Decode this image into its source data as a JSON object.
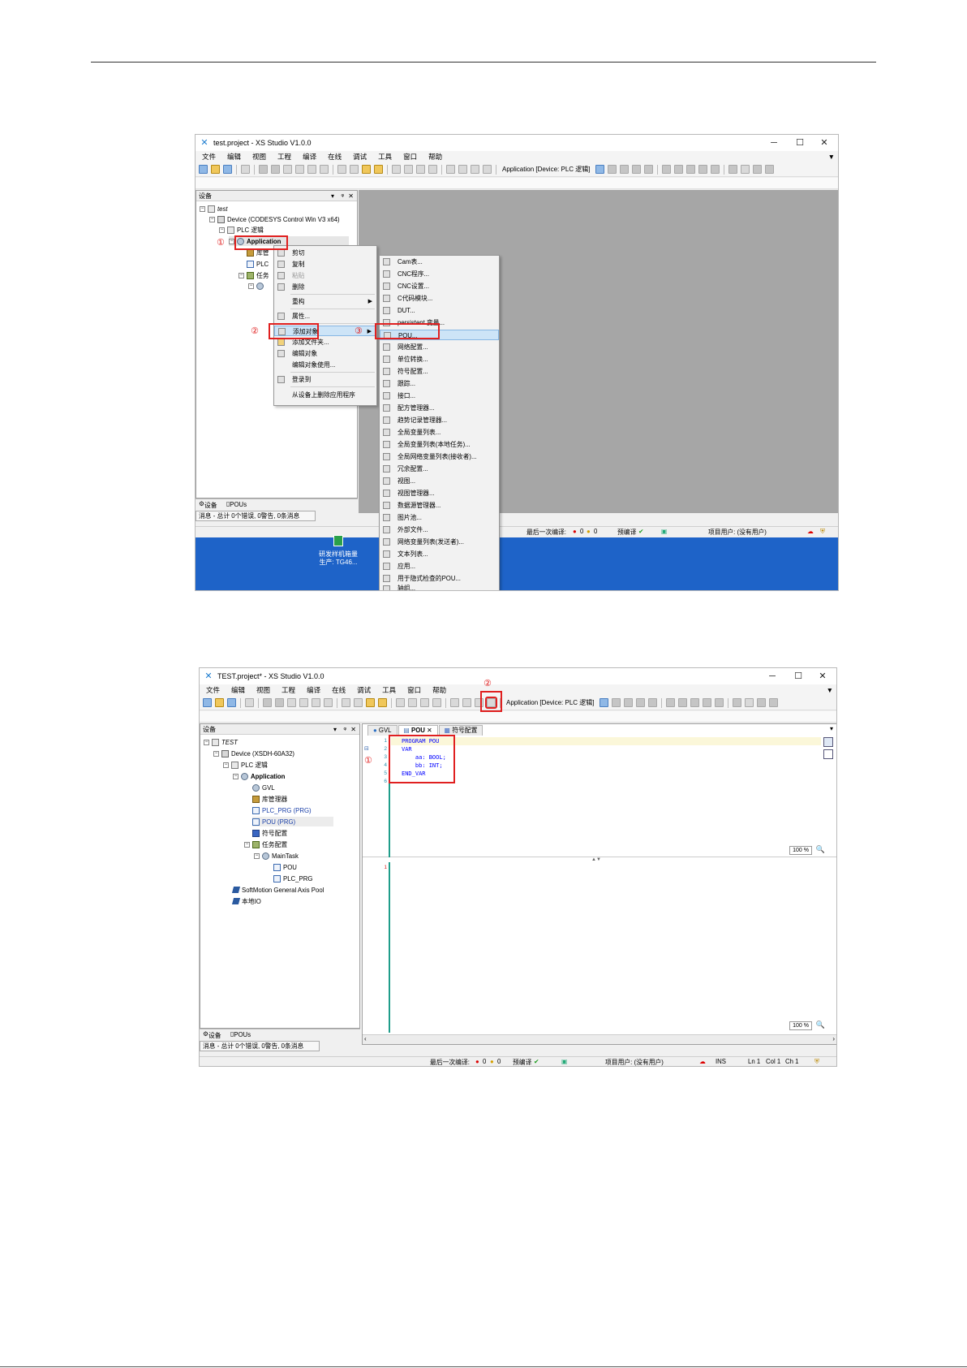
{
  "shot1": {
    "title": "test.project - XS Studio V1.0.0",
    "menu": [
      "文件",
      "编辑",
      "视图",
      "工程",
      "编译",
      "在线",
      "调试",
      "工具",
      "窗口",
      "帮助"
    ],
    "toolbar_app": "Application [Device: PLC 逻辑]",
    "devices_title": "设备",
    "tree": {
      "root": "test",
      "device": "Device (CODESYS Control Win V3 x64)",
      "plc": "PLC 逻辑",
      "application": "Application",
      "lib": "库管",
      "plcprg": "PLC",
      "task": "任务"
    },
    "context_menu": [
      "剪切",
      "复制",
      "粘贴",
      "删除",
      "重构",
      "属性...",
      "添加对象",
      "添加文件夹...",
      "编辑对象",
      "编辑对象使用...",
      "登录到",
      "从设备上删除应用程序"
    ],
    "add_menu": [
      "Cam表...",
      "CNC程序...",
      "CNC设置...",
      "C代码模块...",
      "DUT...",
      "persistent 变量...",
      "POU...",
      "网络配置...",
      "单位转换...",
      "符号配置...",
      "跟踪...",
      "接口...",
      "配方管理器...",
      "趋势记录管理器...",
      "全局变量列表...",
      "全局变量列表(本地任务)...",
      "全局网络变量列表(接收者)...",
      "冗余配置...",
      "视图...",
      "视图管理器...",
      "数据源管理器...",
      "图片池...",
      "外部文件...",
      "网络变量列表(发送者)...",
      "文本列表...",
      "应用...",
      "用于隐式检查的POU...",
      "轴组..."
    ],
    "bottom_tabs": [
      "设备",
      "POUs"
    ],
    "messages": "消息 - 总计 0个错误, 0警告, 0条消息",
    "status": {
      "last_compile": "最后一次编译:",
      "errors": "0",
      "warnings": "0",
      "precompile": "预编译",
      "project_user": "项目用户: (没有用户)"
    },
    "desktop": {
      "line1": "研发样机箱量",
      "line2": "生产: TG46..."
    },
    "annotations": [
      "①",
      "②",
      "③"
    ]
  },
  "shot2": {
    "title": "TEST.project* - XS Studio V1.0.0",
    "menu": [
      "文件",
      "编辑",
      "视图",
      "工程",
      "编译",
      "在线",
      "调试",
      "工具",
      "窗口",
      "帮助"
    ],
    "toolbar_app": "Application [Device: PLC 逻辑]",
    "devices_title": "设备",
    "tree": {
      "root": "TEST",
      "device": "Device (XSDH-60A32)",
      "plc": "PLC 逻辑",
      "application": "Application",
      "gvl": "GVL",
      "lib": "库管理器",
      "plcprg": "PLC_PRG (PRG)",
      "pou": "POU (PRG)",
      "symbol": "符号配置",
      "taskcfg": "任务配置",
      "maintask": "MainTask",
      "task_pou": "POU",
      "task_plcprg": "PLC_PRG",
      "axispool": "SoftMotion General Axis Pool",
      "localio": "本地IO"
    },
    "tabs": [
      "GVL",
      "POU",
      "符号配置"
    ],
    "code": [
      "PROGRAM POU",
      "VAR",
      "    aa: BOOL;",
      "    bb: INT;",
      "END_VAR",
      ""
    ],
    "line_numbers": [
      "1",
      "2",
      "3",
      "4",
      "5",
      "6"
    ],
    "impl_line": "1",
    "zoom": "100 %",
    "bottom_tabs": [
      "设备",
      "POUs"
    ],
    "messages": "消息 - 总计 0个错误, 0警告, 0条消息",
    "status": {
      "last_compile": "最后一次编译:",
      "errors": "0",
      "warnings": "0",
      "precompile": "预编译",
      "project_user": "项目用户: (没有用户)",
      "ins": "INS",
      "ln": "Ln 1",
      "col": "Col 1",
      "ch": "Ch 1"
    },
    "annotations": [
      "①",
      "②"
    ]
  }
}
